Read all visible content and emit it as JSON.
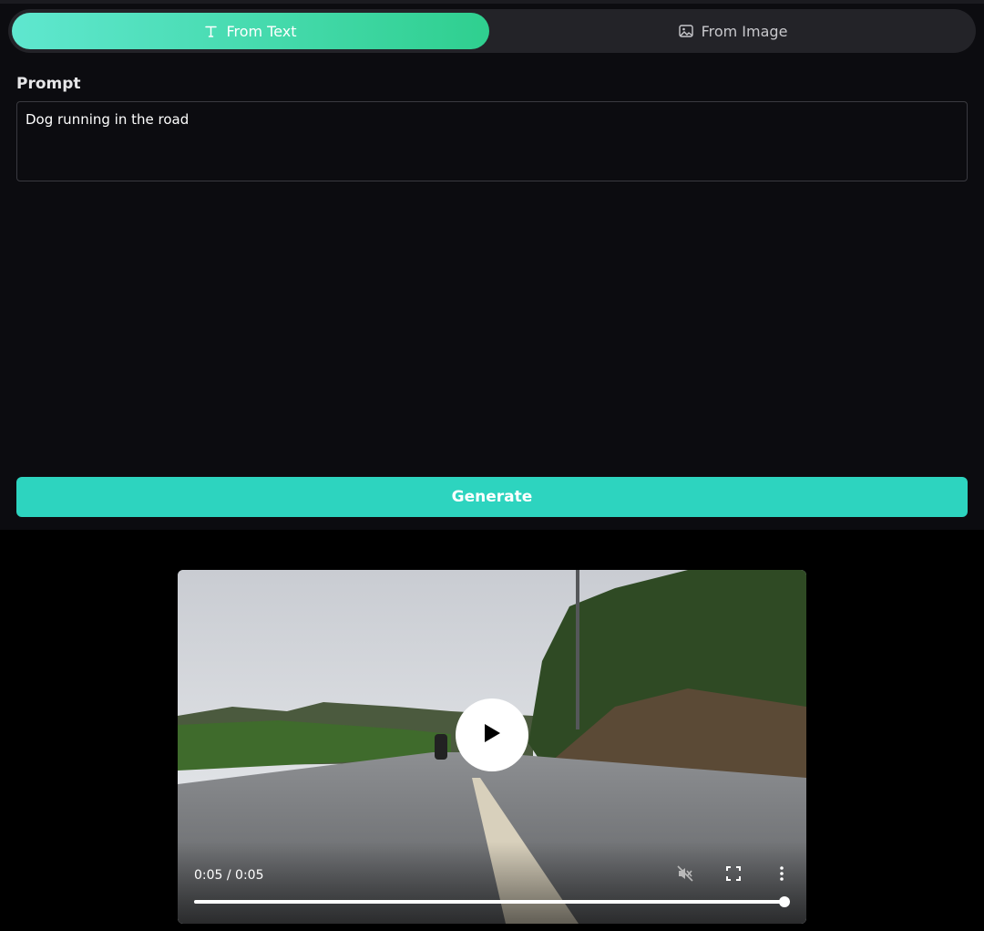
{
  "tabs": [
    {
      "label": "From Text",
      "icon": "text-icon",
      "active": true
    },
    {
      "label": "From Image",
      "icon": "image-icon",
      "active": false
    }
  ],
  "prompt": {
    "label": "Prompt",
    "value": "Dog running in the road"
  },
  "generate": {
    "label": "Generate"
  },
  "video": {
    "time": "0:05 / 0:05",
    "progress": 1.0,
    "icons": [
      "play-icon",
      "mute-icon",
      "fullscreen-icon",
      "more-options-icon"
    ]
  },
  "colors": {
    "accent": "#2dd4bf",
    "tab_gradient_start": "#5fe7cf",
    "tab_gradient_end": "#2fcf8f",
    "panel_bg": "#0c0c10",
    "page_bg": "#000000"
  }
}
